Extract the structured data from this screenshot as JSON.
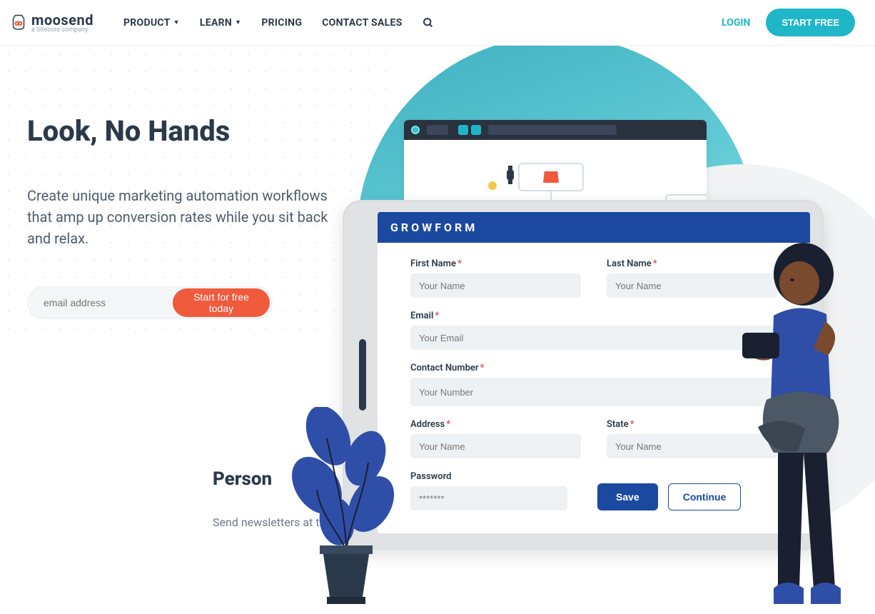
{
  "brand": {
    "name": "moosend",
    "sub": "a Sitecore company"
  },
  "nav": {
    "product": "PRODUCT",
    "learn": "LEARN",
    "pricing": "PRICING",
    "contact": "CONTACT SALES"
  },
  "auth": {
    "login": "LOGIN",
    "start": "START FREE"
  },
  "hero": {
    "title": "Look, No Hands",
    "body": "Create unique marketing automation workflows that amp up conversion rates while you sit back and relax.",
    "email_placeholder": "email address",
    "cta": "Start for free today"
  },
  "lower": {
    "title": "Person",
    "sub": "Send newsletters at the"
  },
  "form": {
    "brand": "GROWFORM",
    "first": {
      "label": "First Name",
      "ph": "Your Name"
    },
    "last": {
      "label": "Last Name",
      "ph": "Your Name"
    },
    "email": {
      "label": "Email",
      "ph": "Your Email"
    },
    "phone": {
      "label": "Contact Number",
      "ph": "Your Number"
    },
    "address": {
      "label": "Address",
      "ph": "Your Name"
    },
    "state": {
      "label": "State",
      "ph": "Your Name"
    },
    "password": {
      "label": "Password",
      "ph": "*******"
    },
    "save": "Save",
    "continue": "Continue"
  }
}
